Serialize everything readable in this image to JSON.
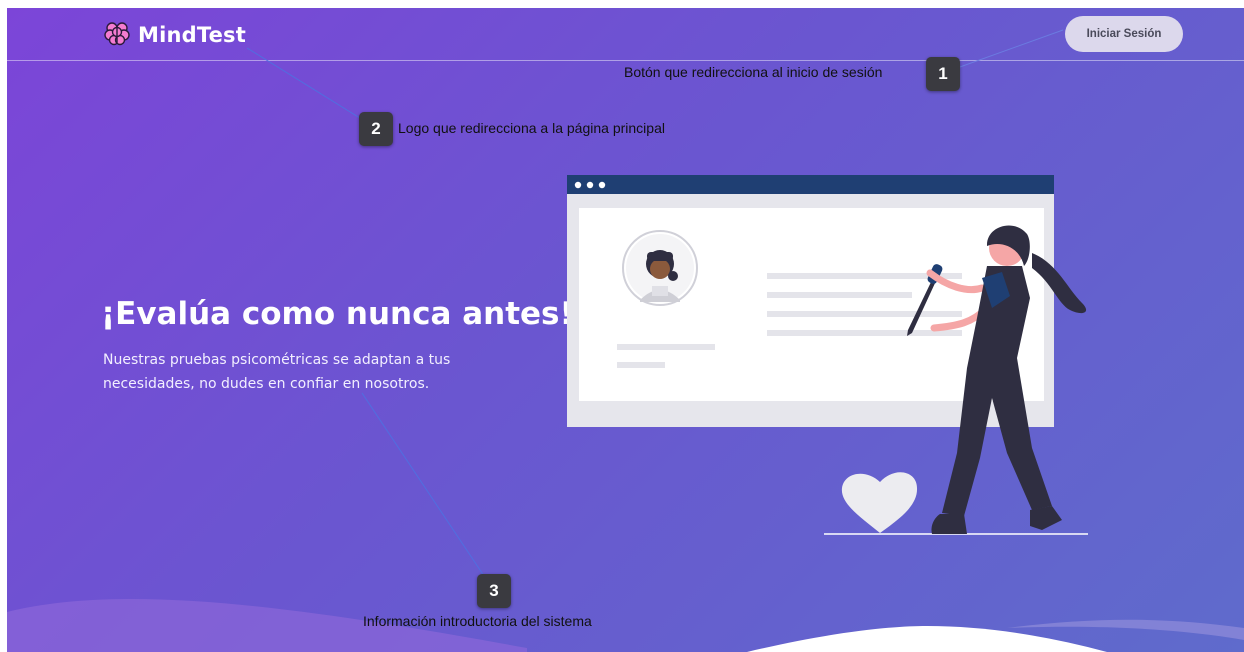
{
  "navbar": {
    "logo_text": "MindTest",
    "login_label": "Iniciar Sesión"
  },
  "hero": {
    "title": "¡Evalúa como nunca antes!",
    "subtitle": "Nuestras pruebas psicométricas se adaptan a tus necesidades, no dudes en confiar en nosotros."
  },
  "annotations": [
    {
      "number": "1",
      "text": "Botón que redirecciona al inicio de sesión"
    },
    {
      "number": "2",
      "text": "Logo que redirecciona a la página principal"
    },
    {
      "number": "3",
      "text": "Información introductoria del sistema"
    }
  ],
  "colors": {
    "gradient_start": "#7c45d8",
    "gradient_end": "#5f6bcc",
    "button_bg": "#dcd8ec",
    "illustration_header": "#1f3f73",
    "figure_dark": "#2f2e41"
  },
  "icons": [
    "brain-icon",
    "heart-illustration",
    "person-illustration",
    "browser-window-illustration"
  ]
}
